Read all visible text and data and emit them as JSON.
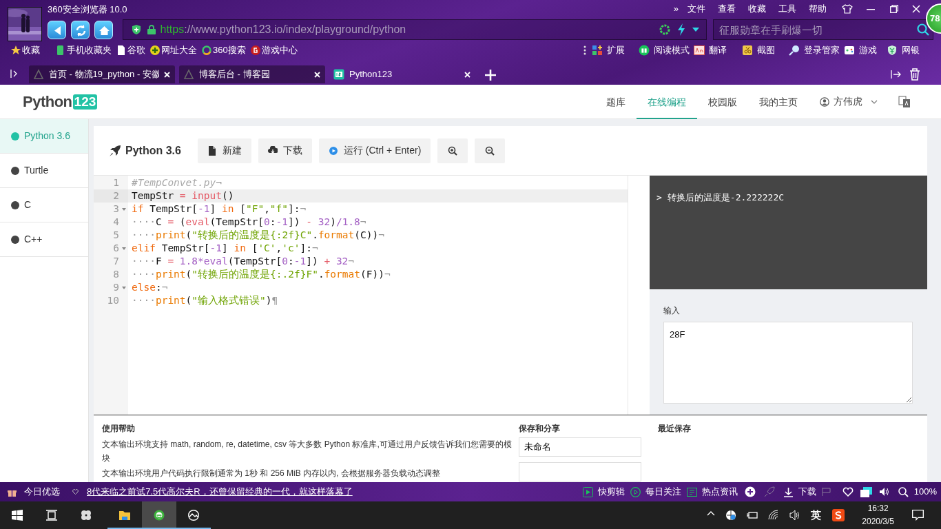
{
  "browser": {
    "title": "360安全浏览器 10.0",
    "menu": [
      "»",
      "文件",
      "查看",
      "收藏",
      "工具",
      "帮助"
    ],
    "badge": "78",
    "address": {
      "scheme": "https",
      "rest": "://www.python123.io/index/playground/python"
    },
    "search": {
      "placeholder": "征服勋章在手刷爆一切"
    },
    "bookmarks": [
      "收藏",
      "手机收藏夹",
      "谷歌",
      "网址大全",
      "360搜索",
      "游戏中心"
    ],
    "tools": [
      "扩展",
      "阅读模式",
      "翻译",
      "截图",
      "登录管家",
      "游戏",
      "网银"
    ],
    "tabs": [
      {
        "label": "首页 - 物流19_python - 安徽",
        "selected": false
      },
      {
        "label": "博客后台 - 博客园",
        "selected": false
      },
      {
        "label": "Python123",
        "selected": true
      }
    ]
  },
  "site": {
    "logo": {
      "name": "Python",
      "number": "123"
    },
    "nav": [
      {
        "label": "题库",
        "selected": false
      },
      {
        "label": "在线编程",
        "selected": true
      },
      {
        "label": "校园版",
        "selected": false
      },
      {
        "label": "我的主页",
        "selected": false
      }
    ],
    "user": "方伟虎"
  },
  "sidebar": {
    "items": [
      {
        "label": "Python 3.6",
        "selected": true
      },
      {
        "label": "Turtle",
        "selected": false
      },
      {
        "label": "C",
        "selected": false
      },
      {
        "label": "C++",
        "selected": false
      }
    ]
  },
  "toolbar": {
    "title": "Python 3.6",
    "buttons": [
      "新建",
      "下载",
      "运行 (Ctrl + Enter)"
    ]
  },
  "editor": {
    "lines": [
      {
        "number": "1",
        "foldable": false,
        "active": false,
        "tokens": [
          {
            "t": "#TempConvet.py",
            "kind": "comment"
          },
          {
            "t": "¬",
            "kind": "inv"
          }
        ]
      },
      {
        "number": "2",
        "foldable": false,
        "active": true,
        "tokens": [
          {
            "t": "TempStr ",
            "kind": "plain"
          },
          {
            "t": "=",
            "kind": "op"
          },
          {
            "t": " input",
            "kind": "builtin"
          },
          {
            "t": "()",
            "kind": "plain"
          }
        ]
      },
      {
        "number": "3",
        "foldable": true,
        "active": false,
        "tokens": [
          {
            "t": "if",
            "kind": "kw"
          },
          {
            "t": " TempStr[",
            "kind": "plain"
          },
          {
            "t": "-1",
            "kind": "num"
          },
          {
            "t": "] ",
            "kind": "plain"
          },
          {
            "t": "in",
            "kind": "kw"
          },
          {
            "t": " [",
            "kind": "plain"
          },
          {
            "t": "\"F\"",
            "kind": "str"
          },
          {
            "t": ",",
            "kind": "plain"
          },
          {
            "t": "\"f\"",
            "kind": "str"
          },
          {
            "t": "]:",
            "kind": "plain"
          },
          {
            "t": "¬",
            "kind": "inv"
          }
        ]
      },
      {
        "number": "4",
        "foldable": false,
        "active": false,
        "tokens": [
          {
            "t": "····",
            "kind": "inv"
          },
          {
            "t": "C ",
            "kind": "plain"
          },
          {
            "t": "=",
            "kind": "op"
          },
          {
            "t": " (",
            "kind": "plain"
          },
          {
            "t": "eval",
            "kind": "builtin"
          },
          {
            "t": "(TempStr[",
            "kind": "plain"
          },
          {
            "t": "0",
            "kind": "num"
          },
          {
            "t": ":",
            "kind": "plain"
          },
          {
            "t": "-1",
            "kind": "num"
          },
          {
            "t": "]) ",
            "kind": "plain"
          },
          {
            "t": "-",
            "kind": "op"
          },
          {
            "t": " 32",
            "kind": "num"
          },
          {
            "t": ")",
            "kind": "plain"
          },
          {
            "t": "/1.8",
            "kind": "num"
          },
          {
            "t": "¬",
            "kind": "inv"
          }
        ]
      },
      {
        "number": "5",
        "foldable": false,
        "active": false,
        "tokens": [
          {
            "t": "····",
            "kind": "inv"
          },
          {
            "t": "print",
            "kind": "fn"
          },
          {
            "t": "(",
            "kind": "plain"
          },
          {
            "t": "\"转换后的温度是{:2f}C\"",
            "kind": "str"
          },
          {
            "t": ".",
            "kind": "plain"
          },
          {
            "t": "format",
            "kind": "fn"
          },
          {
            "t": "(C))",
            "kind": "plain"
          },
          {
            "t": "¬",
            "kind": "inv"
          }
        ]
      },
      {
        "number": "6",
        "foldable": true,
        "active": false,
        "tokens": [
          {
            "t": "elif",
            "kind": "kw"
          },
          {
            "t": " TempStr[",
            "kind": "plain"
          },
          {
            "t": "-1",
            "kind": "num"
          },
          {
            "t": "] ",
            "kind": "plain"
          },
          {
            "t": "in",
            "kind": "kw"
          },
          {
            "t": " [",
            "kind": "plain"
          },
          {
            "t": "'C'",
            "kind": "str"
          },
          {
            "t": ",",
            "kind": "plain"
          },
          {
            "t": "'c'",
            "kind": "str"
          },
          {
            "t": "]:",
            "kind": "plain"
          },
          {
            "t": "¬",
            "kind": "inv"
          }
        ]
      },
      {
        "number": "7",
        "foldable": false,
        "active": false,
        "tokens": [
          {
            "t": "····",
            "kind": "inv"
          },
          {
            "t": "F ",
            "kind": "plain"
          },
          {
            "t": "=",
            "kind": "op"
          },
          {
            "t": " 1.8*eval",
            "kind": "num"
          },
          {
            "t": "(TempStr[",
            "kind": "plain"
          },
          {
            "t": "0",
            "kind": "num"
          },
          {
            "t": ":",
            "kind": "plain"
          },
          {
            "t": "-1",
            "kind": "num"
          },
          {
            "t": "]) ",
            "kind": "plain"
          },
          {
            "t": "+",
            "kind": "op"
          },
          {
            "t": " 32",
            "kind": "num"
          },
          {
            "t": "¬",
            "kind": "inv"
          }
        ]
      },
      {
        "number": "8",
        "foldable": false,
        "active": false,
        "tokens": [
          {
            "t": "····",
            "kind": "inv"
          },
          {
            "t": "print",
            "kind": "fn"
          },
          {
            "t": "(",
            "kind": "plain"
          },
          {
            "t": "\"转换后的温度是{:.2f}F\"",
            "kind": "str"
          },
          {
            "t": ".",
            "kind": "plain"
          },
          {
            "t": "format",
            "kind": "fn"
          },
          {
            "t": "(F))",
            "kind": "plain"
          },
          {
            "t": "¬",
            "kind": "inv"
          }
        ]
      },
      {
        "number": "9",
        "foldable": true,
        "active": false,
        "tokens": [
          {
            "t": "else",
            "kind": "kw"
          },
          {
            "t": ":",
            "kind": "plain"
          },
          {
            "t": "¬",
            "kind": "inv"
          }
        ]
      },
      {
        "number": "10",
        "foldable": false,
        "active": false,
        "tokens": [
          {
            "t": "····",
            "kind": "inv"
          },
          {
            "t": "print",
            "kind": "fn"
          },
          {
            "t": "(",
            "kind": "plain"
          },
          {
            "t": "\"输入格式错误\"",
            "kind": "str"
          },
          {
            "t": ")",
            "kind": "plain"
          },
          {
            "t": "¶",
            "kind": "inv"
          }
        ]
      }
    ]
  },
  "output": {
    "lines": [
      {
        "prompt": ">",
        "text": "转换后的温度是-2.222222C"
      }
    ]
  },
  "input": {
    "label": "输入",
    "value": "28F"
  },
  "help": {
    "title": "使用帮助",
    "paragraphs": [
      "文本输出环境支持 math, random, re, datetime, csv 等大多数 Python 标准库,可通过用户反馈告诉我们您需要的模块",
      "文本输出环境用户代码执行限制通常为 1秒 和 256 MiB 内存以内, 会根据服务器负载动态调整"
    ]
  },
  "save": {
    "title": "保存和分享",
    "name_value": "未命名"
  },
  "recent": {
    "title": "最近保存"
  },
  "status_bar": {
    "label": "今日优选",
    "headline": "8代来临之前试7.5代高尔夫R，还曾保留经典的一代，就这样落幕了",
    "items": [
      "快剪辑",
      "每日关注",
      "热点资讯",
      "下载"
    ],
    "zoom": "100%"
  },
  "taskbar": {
    "ime": "英",
    "time": "16:32",
    "date": "2020/3/5"
  }
}
